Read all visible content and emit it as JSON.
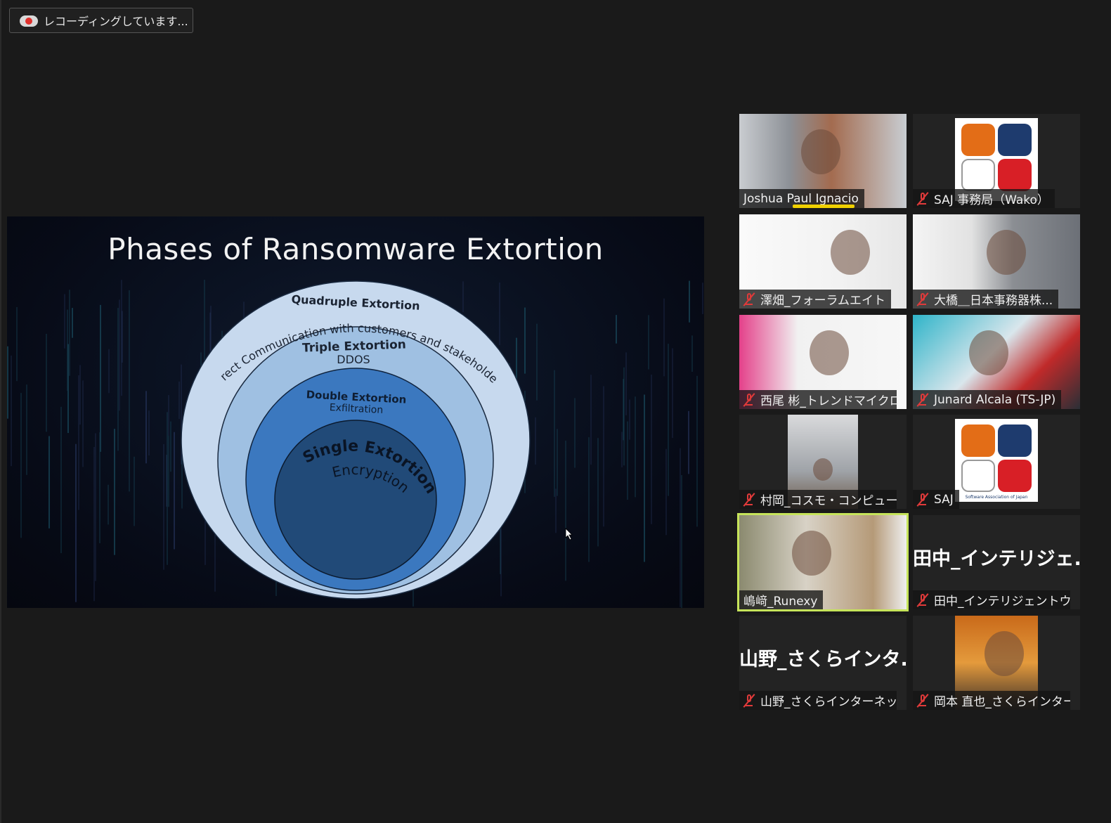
{
  "recording": {
    "label": "レコーディングしています..."
  },
  "slide": {
    "title": "Phases of Ransomware Extortion",
    "rings": [
      {
        "title": "Quadruple Extortion",
        "subtitle": "Direct Communication with customers and stakeholders",
        "color": "#c7d9ee"
      },
      {
        "title": "Triple Extortion",
        "subtitle": "DDOS",
        "color": "#9fc0e2"
      },
      {
        "title": "Double Extortion",
        "subtitle": "Exfiltration",
        "color": "#3b78bf"
      },
      {
        "title": "Single Extortion",
        "subtitle": "Encryption",
        "color": "#214a78"
      }
    ]
  },
  "participants": [
    {
      "name": "Joshua Paul Ignacio",
      "muted": false,
      "speaking": true,
      "kind": "video"
    },
    {
      "name": "SAJ 事務局（Wako）",
      "muted": true,
      "kind": "logo"
    },
    {
      "name": "澤畑_フォーラムエイト",
      "muted": true,
      "kind": "video"
    },
    {
      "name": "大橋＿日本事務器株...",
      "muted": true,
      "kind": "video"
    },
    {
      "name": "西尾 彬_トレンドマイクロ...",
      "muted": true,
      "kind": "video"
    },
    {
      "name": "Junard Alcala (TS-JP)",
      "muted": true,
      "kind": "video"
    },
    {
      "name": "村岡_コスモ・コンピューテ...",
      "muted": true,
      "kind": "video"
    },
    {
      "name": "SAJ",
      "muted": true,
      "kind": "logo",
      "logo_caption": "Software Association of Japan"
    },
    {
      "name": "嶋﨑_Runexy",
      "muted": false,
      "active": true,
      "kind": "video"
    },
    {
      "name": "田中_インテリジェントウェ...",
      "muted": true,
      "kind": "name",
      "display": "田中_インテリジェ..."
    },
    {
      "name": "山野_さくらインターネット...",
      "muted": true,
      "kind": "name",
      "display": "山野_さくらインタ..."
    },
    {
      "name": "岡本 直也_さくらインター...",
      "muted": true,
      "kind": "video"
    }
  ],
  "colors": {
    "active_border": "#c6e45a",
    "mic_off": "#e03a3a",
    "speaking": "#f0d000"
  }
}
